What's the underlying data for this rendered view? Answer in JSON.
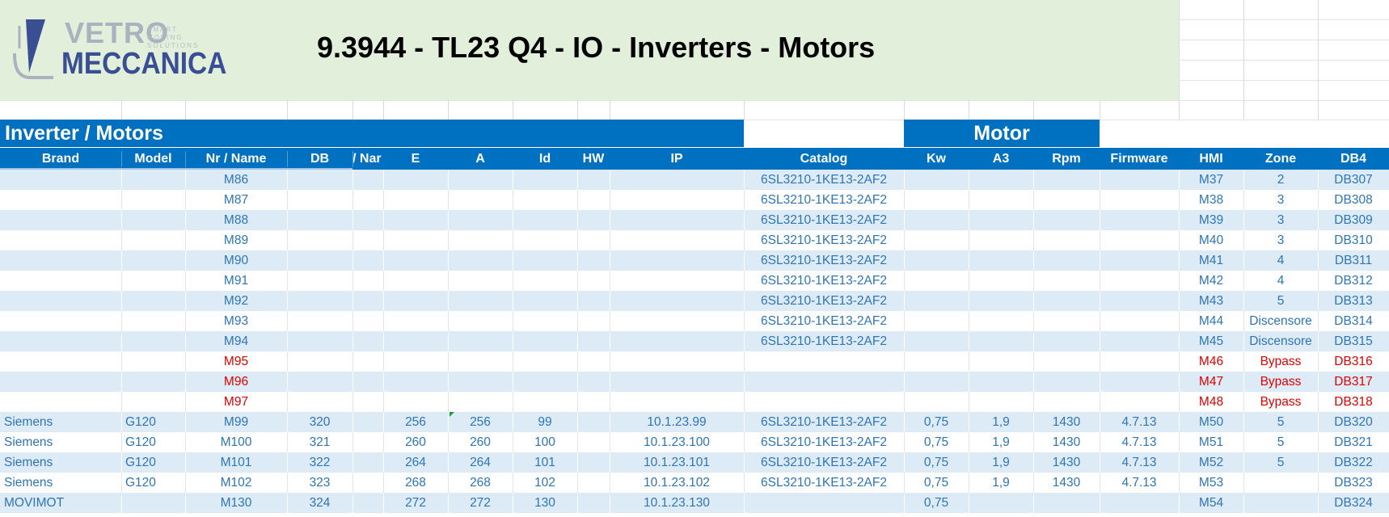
{
  "title": "9.3944 - TL23 Q4 - IO - Inverters - Motors",
  "logo": {
    "line1": "VETRO",
    "line2": "MECCANICA",
    "tagline": "SMART MOVING SOLUTIONS"
  },
  "bands": {
    "inverter": "Inverter / Motors",
    "motor": "Motor"
  },
  "columns": [
    "Brand",
    "Model",
    "Nr / Name",
    "DB",
    "/ Nar",
    "E",
    "A",
    "Id",
    "HW",
    "IP",
    "Catalog",
    "Kw",
    "A3",
    "Rpm",
    "Firmware",
    "HMI",
    "Zone",
    "DB4"
  ],
  "rows": [
    {
      "brand": "",
      "model": "",
      "name": "M86",
      "db": "",
      "e": "",
      "a": "",
      "id": "",
      "hw": "",
      "ip": "",
      "catalog": "6SL3210-1KE13-2AF2",
      "kw": "",
      "a3": "",
      "rpm": "",
      "fw": "",
      "hmi": "M37",
      "zone": "2",
      "db4": "DB307",
      "red": false
    },
    {
      "brand": "",
      "model": "",
      "name": "M87",
      "db": "",
      "e": "",
      "a": "",
      "id": "",
      "hw": "",
      "ip": "",
      "catalog": "6SL3210-1KE13-2AF2",
      "kw": "",
      "a3": "",
      "rpm": "",
      "fw": "",
      "hmi": "M38",
      "zone": "3",
      "db4": "DB308",
      "red": false
    },
    {
      "brand": "",
      "model": "",
      "name": "M88",
      "db": "",
      "e": "",
      "a": "",
      "id": "",
      "hw": "",
      "ip": "",
      "catalog": "6SL3210-1KE13-2AF2",
      "kw": "",
      "a3": "",
      "rpm": "",
      "fw": "",
      "hmi": "M39",
      "zone": "3",
      "db4": "DB309",
      "red": false
    },
    {
      "brand": "",
      "model": "",
      "name": "M89",
      "db": "",
      "e": "",
      "a": "",
      "id": "",
      "hw": "",
      "ip": "",
      "catalog": "6SL3210-1KE13-2AF2",
      "kw": "",
      "a3": "",
      "rpm": "",
      "fw": "",
      "hmi": "M40",
      "zone": "3",
      "db4": "DB310",
      "red": false
    },
    {
      "brand": "",
      "model": "",
      "name": "M90",
      "db": "",
      "e": "",
      "a": "",
      "id": "",
      "hw": "",
      "ip": "",
      "catalog": "6SL3210-1KE13-2AF2",
      "kw": "",
      "a3": "",
      "rpm": "",
      "fw": "",
      "hmi": "M41",
      "zone": "4",
      "db4": "DB311",
      "red": false
    },
    {
      "brand": "",
      "model": "",
      "name": "M91",
      "db": "",
      "e": "",
      "a": "",
      "id": "",
      "hw": "",
      "ip": "",
      "catalog": "6SL3210-1KE13-2AF2",
      "kw": "",
      "a3": "",
      "rpm": "",
      "fw": "",
      "hmi": "M42",
      "zone": "4",
      "db4": "DB312",
      "red": false
    },
    {
      "brand": "",
      "model": "",
      "name": "M92",
      "db": "",
      "e": "",
      "a": "",
      "id": "",
      "hw": "",
      "ip": "",
      "catalog": "6SL3210-1KE13-2AF2",
      "kw": "",
      "a3": "",
      "rpm": "",
      "fw": "",
      "hmi": "M43",
      "zone": "5",
      "db4": "DB313",
      "red": false
    },
    {
      "brand": "",
      "model": "",
      "name": "M93",
      "db": "",
      "e": "",
      "a": "",
      "id": "",
      "hw": "",
      "ip": "",
      "catalog": "6SL3210-1KE13-2AF2",
      "kw": "",
      "a3": "",
      "rpm": "",
      "fw": "",
      "hmi": "M44",
      "zone": "Discensore",
      "db4": "DB314",
      "red": false
    },
    {
      "brand": "",
      "model": "",
      "name": "M94",
      "db": "",
      "e": "",
      "a": "",
      "id": "",
      "hw": "",
      "ip": "",
      "catalog": "6SL3210-1KE13-2AF2",
      "kw": "",
      "a3": "",
      "rpm": "",
      "fw": "",
      "hmi": "M45",
      "zone": "Discensore",
      "db4": "DB315",
      "red": false
    },
    {
      "brand": "",
      "model": "",
      "name": "M95",
      "db": "",
      "e": "",
      "a": "",
      "id": "",
      "hw": "",
      "ip": "",
      "catalog": "",
      "kw": "",
      "a3": "",
      "rpm": "",
      "fw": "",
      "hmi": "M46",
      "zone": "Bypass",
      "db4": "DB316",
      "red": true
    },
    {
      "brand": "",
      "model": "",
      "name": "M96",
      "db": "",
      "e": "",
      "a": "",
      "id": "",
      "hw": "",
      "ip": "",
      "catalog": "",
      "kw": "",
      "a3": "",
      "rpm": "",
      "fw": "",
      "hmi": "M47",
      "zone": "Bypass",
      "db4": "DB317",
      "red": true
    },
    {
      "brand": "",
      "model": "",
      "name": "M97",
      "db": "",
      "e": "",
      "a": "",
      "id": "",
      "hw": "",
      "ip": "",
      "catalog": "",
      "kw": "",
      "a3": "",
      "rpm": "",
      "fw": "",
      "hmi": "M48",
      "zone": "Bypass",
      "db4": "DB318",
      "red": true
    },
    {
      "brand": "Siemens",
      "model": "G120",
      "name": "M99",
      "db": "320",
      "e": "256",
      "a": "256",
      "id": "99",
      "hw": "",
      "ip": "10.1.23.99",
      "catalog": "6SL3210-1KE13-2AF2",
      "kw": "0,75",
      "a3": "1,9",
      "rpm": "1430",
      "fw": "4.7.13",
      "hmi": "M50",
      "zone": "5",
      "db4": "DB320",
      "red": false
    },
    {
      "brand": "Siemens",
      "model": "G120",
      "name": "M100",
      "db": "321",
      "e": "260",
      "a": "260",
      "id": "100",
      "hw": "",
      "ip": "10.1.23.100",
      "catalog": "6SL3210-1KE13-2AF2",
      "kw": "0,75",
      "a3": "1,9",
      "rpm": "1430",
      "fw": "4.7.13",
      "hmi": "M51",
      "zone": "5",
      "db4": "DB321",
      "red": false
    },
    {
      "brand": "Siemens",
      "model": "G120",
      "name": "M101",
      "db": "322",
      "e": "264",
      "a": "264",
      "id": "101",
      "hw": "",
      "ip": "10.1.23.101",
      "catalog": "6SL3210-1KE13-2AF2",
      "kw": "0,75",
      "a3": "1,9",
      "rpm": "1430",
      "fw": "4.7.13",
      "hmi": "M52",
      "zone": "5",
      "db4": "DB322",
      "red": false
    },
    {
      "brand": "Siemens",
      "model": "G120",
      "name": "M102",
      "db": "323",
      "e": "268",
      "a": "268",
      "id": "102",
      "hw": "",
      "ip": "10.1.23.102",
      "catalog": "6SL3210-1KE13-2AF2",
      "kw": "0,75",
      "a3": "1,9",
      "rpm": "1430",
      "fw": "4.7.13",
      "hmi": "M53",
      "zone": "",
      "db4": "DB323",
      "red": false
    },
    {
      "brand": "MOVIMOT",
      "model": "",
      "name": "M130",
      "db": "324",
      "e": "272",
      "a": "272",
      "id": "130",
      "hw": "",
      "ip": "10.1.23.130",
      "catalog": "",
      "kw": "0,75",
      "a3": "",
      "rpm": "",
      "fw": "",
      "hmi": "M54",
      "zone": "",
      "db4": "DB324",
      "red": false
    }
  ]
}
